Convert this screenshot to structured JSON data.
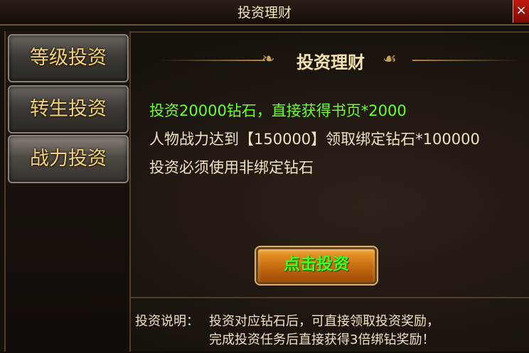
{
  "window": {
    "title": "投资理财",
    "close_label": "×"
  },
  "sidebar": {
    "items": [
      {
        "label": "等级投资"
      },
      {
        "label": "转生投资"
      },
      {
        "label": "战力投资"
      }
    ]
  },
  "panel": {
    "title": "投资理财",
    "lines": [
      "投资20000钻石，直接获得书页*2000",
      "人物战力达到【150000】领取绑定钻石*100000",
      "投资必须使用非绑定钻石"
    ],
    "invest_button": "点击投资"
  },
  "note": {
    "label": "投资说明：",
    "lines": [
      "投资对应钻石后，可直接领取投资奖励，",
      "完成投资任务后直接获得3倍绑钻奖励！"
    ]
  },
  "colors": {
    "highlight_text": "#6bff2c",
    "gold_text": "#f2d27a"
  }
}
